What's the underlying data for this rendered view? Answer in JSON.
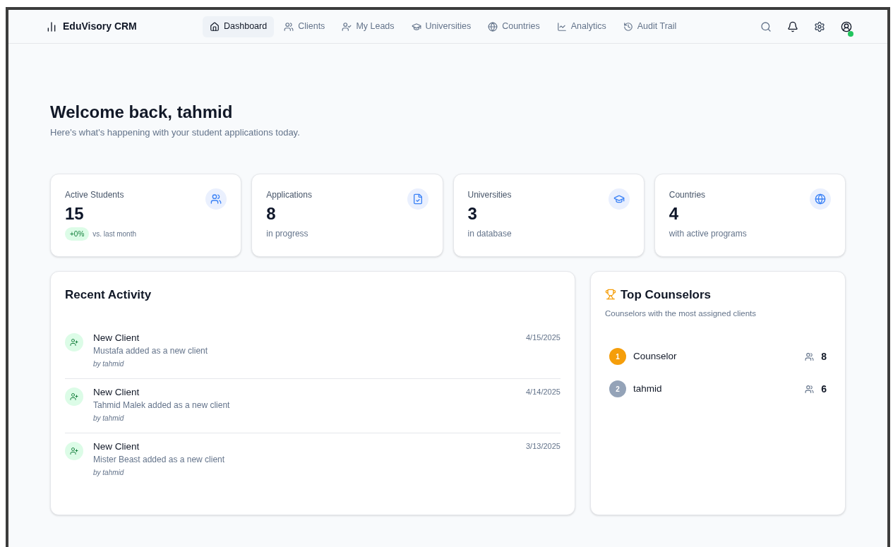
{
  "brand": {
    "name": "EduVisory CRM"
  },
  "nav": [
    {
      "label": "Dashboard",
      "kind": "home",
      "selected": true
    },
    {
      "label": "Clients",
      "kind": "users",
      "selected": false
    },
    {
      "label": "My Leads",
      "kind": "leads",
      "selected": false
    },
    {
      "label": "Universities",
      "kind": "universities",
      "selected": false
    },
    {
      "label": "Countries",
      "kind": "countries",
      "selected": false
    },
    {
      "label": "Analytics",
      "kind": "analytics",
      "selected": false
    },
    {
      "label": "Audit Trail",
      "kind": "audit",
      "selected": false
    }
  ],
  "user": {
    "online": true
  },
  "welcome": {
    "title": "Welcome back, tahmid",
    "subtitle": "Here's what's happening with your student applications today."
  },
  "stats": [
    {
      "label": "Active Students",
      "value": "15",
      "kind": "users",
      "badge": "+0%",
      "note": "vs. last month"
    },
    {
      "label": "Applications",
      "value": "8",
      "kind": "applications",
      "note": "in progress"
    },
    {
      "label": "Universities",
      "value": "3",
      "kind": "universities",
      "note": "in database"
    },
    {
      "label": "Countries",
      "value": "4",
      "kind": "countries",
      "note": "with active programs"
    }
  ],
  "recent_activity": {
    "title": "Recent Activity",
    "items": [
      {
        "title": "New Client",
        "description": "Mustafa added as a new client",
        "by": "by tahmid",
        "date": "4/15/2025"
      },
      {
        "title": "New Client",
        "description": "Tahmid Malek added as a new client",
        "by": "by tahmid",
        "date": "4/14/2025"
      },
      {
        "title": "New Client",
        "description": "Mister Beast added as a new client",
        "by": "by tahmid",
        "date": "3/13/2025"
      }
    ]
  },
  "top_counselors": {
    "title": "Top Counselors",
    "subtitle": "Counselors with the most assigned clients",
    "items": [
      {
        "rank": "1",
        "name": "Counselor",
        "count": "8",
        "color": "#f59e0b"
      },
      {
        "rank": "2",
        "name": "tahmid",
        "count": "6",
        "color": "#94a3b8"
      }
    ]
  }
}
